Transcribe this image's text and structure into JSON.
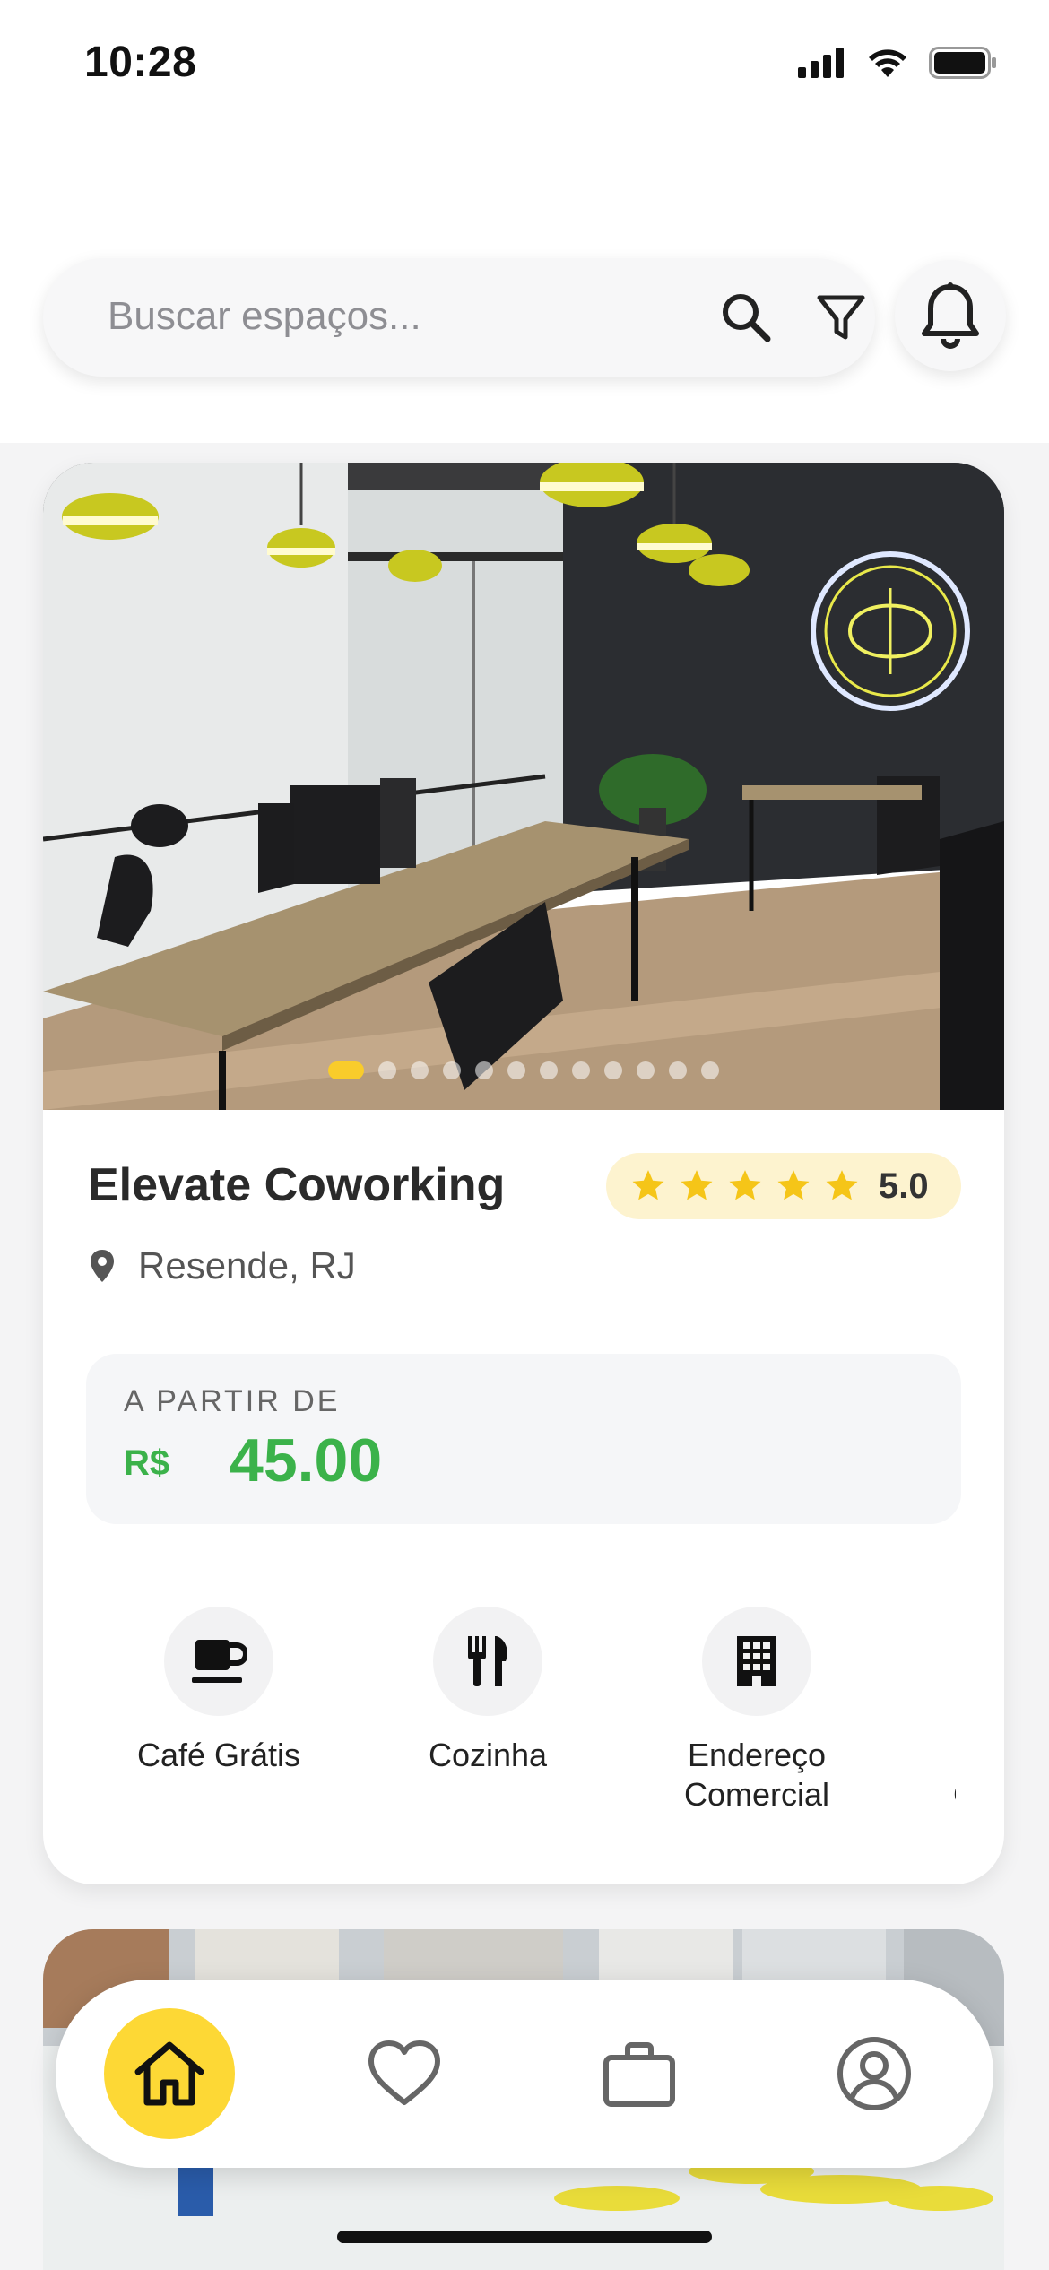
{
  "status_bar": {
    "time": "10:28"
  },
  "search": {
    "placeholder": "Buscar espaços..."
  },
  "card": {
    "title": "Elevate Coworking",
    "rating": "5.0",
    "stars": 5,
    "location": "Resende, RJ",
    "price_label": "A PARTIR DE",
    "price_currency": "R$",
    "price_value": "45.00",
    "carousel_total": 12,
    "carousel_active": 1,
    "amenities": [
      {
        "label": "Café Grátis",
        "icon": "coffee-cup-icon"
      },
      {
        "label": "Cozinha",
        "icon": "fork-knife-icon"
      },
      {
        "label": "Endereço Comercial",
        "icon": "building-icon"
      },
      {
        "label": "Endereço Comercial",
        "icon": "building-icon"
      }
    ]
  },
  "nav": {
    "items": [
      {
        "name": "home",
        "icon": "home-icon",
        "active": true
      },
      {
        "name": "favorites",
        "icon": "heart-icon",
        "active": false
      },
      {
        "name": "bookings",
        "icon": "briefcase-icon",
        "active": false
      },
      {
        "name": "profile",
        "icon": "user-circle-icon",
        "active": false
      }
    ]
  },
  "colors": {
    "accent": "#fdd835",
    "price_green": "#3bb24a",
    "rating_bg": "#fdf3cf",
    "star": "#f5c518"
  }
}
